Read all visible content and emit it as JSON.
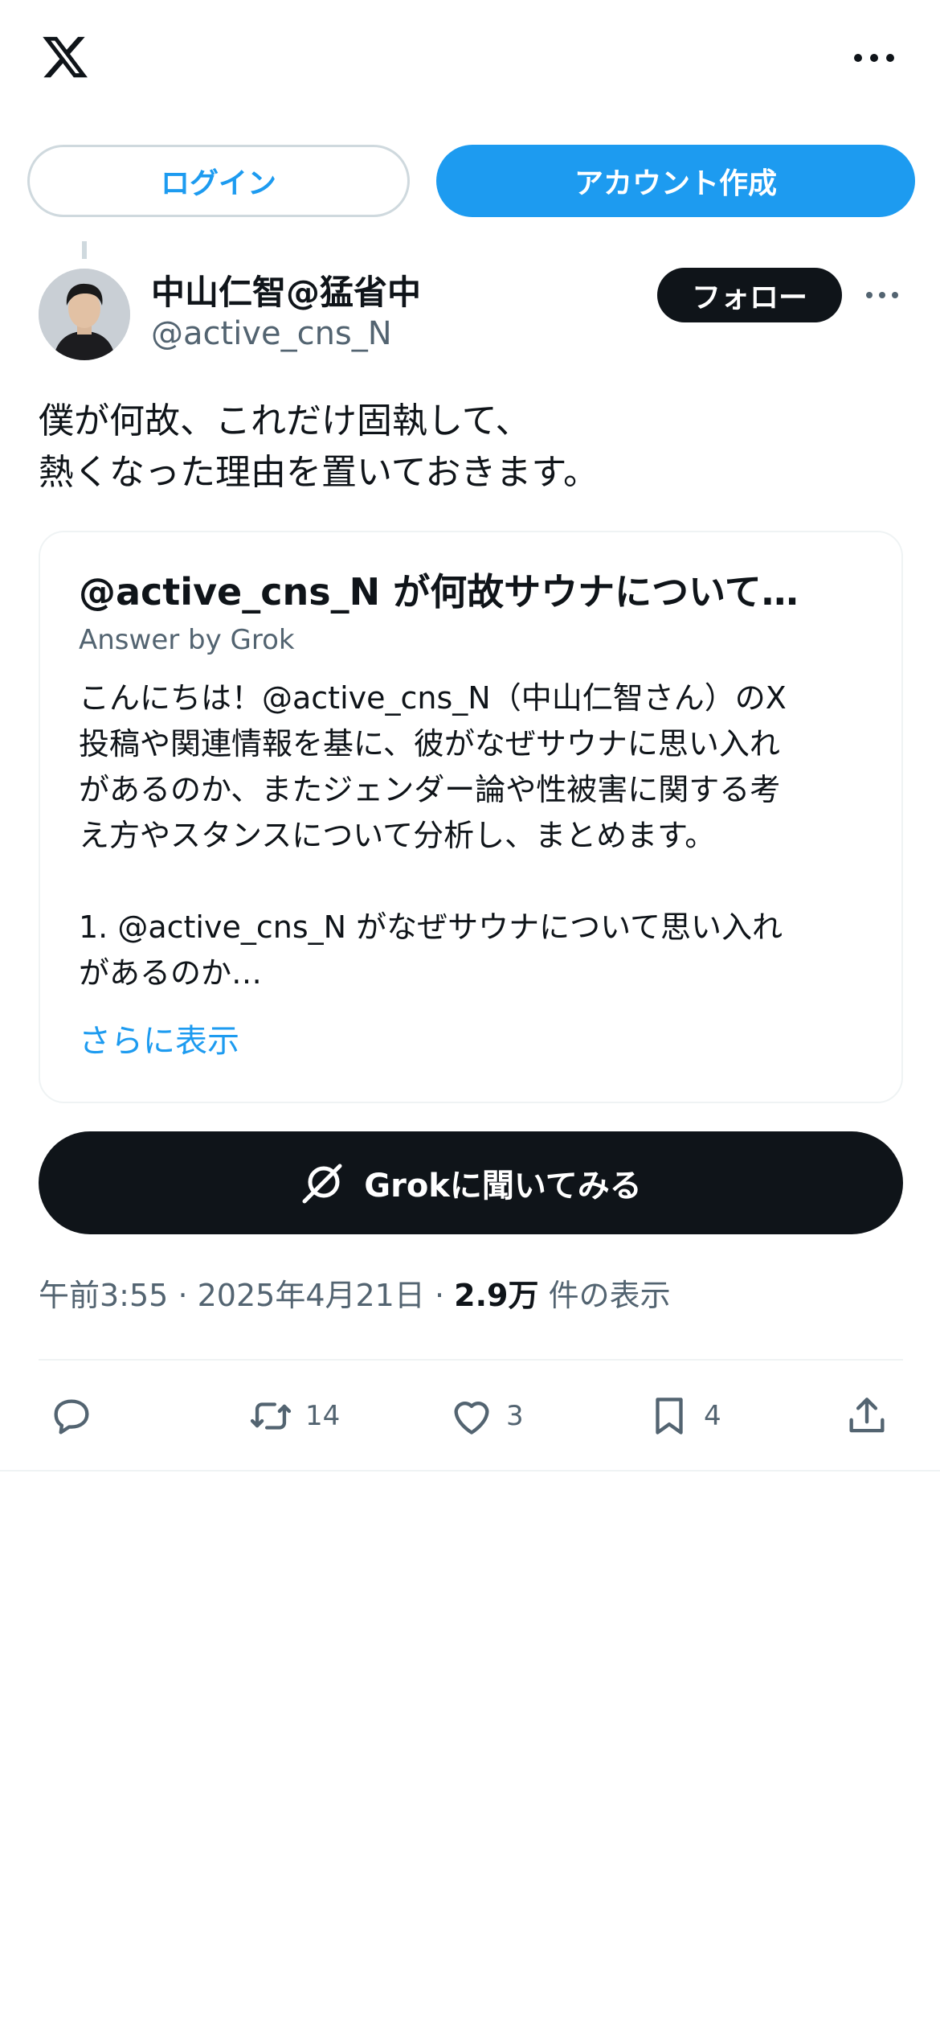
{
  "header": {
    "logo_icon": "x-logo-icon",
    "more_icon": "more-icon"
  },
  "auth": {
    "login_label": "ログイン",
    "signup_label": "アカウント作成"
  },
  "author": {
    "name": "中山仁智@猛省中",
    "handle": "@active_cns_N",
    "follow_label": "フォロー"
  },
  "post": {
    "lines": [
      "僕が何故、これだけ固執して、",
      "熱くなった理由を置いておきます。"
    ]
  },
  "grok_card": {
    "title": "@active_cns_N が何故サウナについて…",
    "subtitle": "Answer by Grok",
    "body_lines": [
      "こんにちは！@active_cns_N（中山仁智さん）のX",
      "投稿や関連情報を基に、彼がなぜサウナに思い入れ",
      "があるのか、またジェンダー論や性被害に関する考",
      "え方やスタンスについて分析し、まとめます。",
      "",
      "1. @active_cns_N がなぜサウナについて思い入れ",
      "があるのか…"
    ],
    "more_label": "さらに表示"
  },
  "ask_grok": {
    "label": "Grokに聞いてみる",
    "icon": "grok-icon"
  },
  "meta": {
    "time": "午前3:55",
    "date": "2025年4月21日",
    "sep": "·",
    "views_count": "2.9万",
    "views_label": "件の表示"
  },
  "actions": {
    "reply": {
      "icon": "reply-icon",
      "count": ""
    },
    "retweet": {
      "icon": "retweet-icon",
      "count": "14"
    },
    "like": {
      "icon": "heart-icon",
      "count": "3"
    },
    "bookmark": {
      "icon": "bookmark-icon",
      "count": "4"
    },
    "share": {
      "icon": "share-icon"
    }
  },
  "colors": {
    "accent": "#1d9bf0",
    "text": "#0f1419",
    "secondary": "#536471",
    "border": "#cfd9de"
  }
}
